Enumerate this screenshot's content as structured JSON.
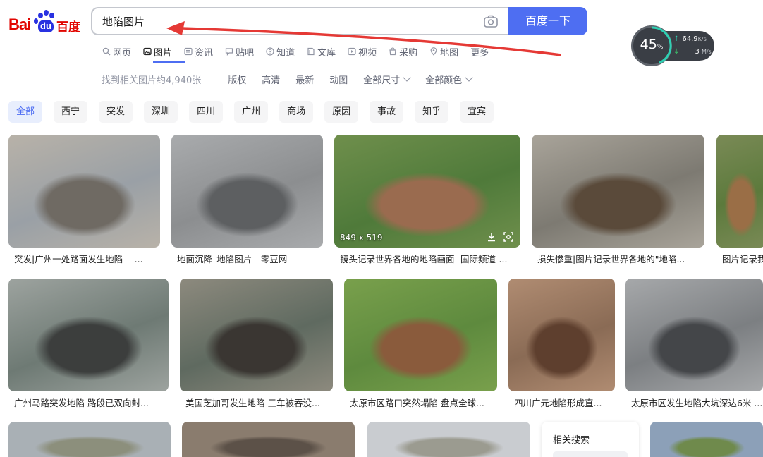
{
  "logo": {
    "latin": "Bai",
    "du": "du",
    "chinese": "百度"
  },
  "search": {
    "query": "地陷图片",
    "button_label": "百度一下"
  },
  "nav": [
    {
      "label": "网页",
      "icon": "search-icon"
    },
    {
      "label": "图片",
      "icon": "image-icon",
      "active": true
    },
    {
      "label": "资讯",
      "icon": "news-icon"
    },
    {
      "label": "贴吧",
      "icon": "tieba-icon"
    },
    {
      "label": "知道",
      "icon": "question-icon"
    },
    {
      "label": "文库",
      "icon": "doc-icon"
    },
    {
      "label": "视频",
      "icon": "video-icon"
    },
    {
      "label": "采购",
      "icon": "shop-icon"
    },
    {
      "label": "地图",
      "icon": "map-icon"
    },
    {
      "label": "更多",
      "icon": ""
    }
  ],
  "filters": {
    "count": "找到相关图片约4,940张",
    "items": [
      "版权",
      "高清",
      "最新",
      "动图"
    ],
    "dropdowns": [
      "全部尺寸",
      "全部颜色"
    ]
  },
  "chips": [
    "全部",
    "西宁",
    "突发",
    "深圳",
    "四川",
    "广州",
    "商场",
    "原因",
    "事故",
    "知乎",
    "宜宾"
  ],
  "row1": [
    {
      "caption": "突发|广州一处路面发生地陷 —...",
      "colors": [
        "#9aa0a6",
        "#6f6a63",
        "#b8b2a8"
      ]
    },
    {
      "caption": "地面沉降_地陷图片 - 零豆网",
      "colors": [
        "#8c8e90",
        "#5d5f61",
        "#a9abad"
      ]
    },
    {
      "caption": "镜头记录世界各地的地陷画面 -国际频道-...",
      "colors": [
        "#4f7a3a",
        "#9a6b4f",
        "#6f8f4c"
      ],
      "size": "849 x 519"
    },
    {
      "caption": "损失惨重|图片记录世界各地的\"地陷...",
      "colors": [
        "#7d7a72",
        "#5a4a3a",
        "#a9a49a"
      ]
    },
    {
      "caption": "图片记录我",
      "colors": [
        "#5c7a3c",
        "#9a6e46",
        "#7a8a56"
      ]
    }
  ],
  "row2": [
    {
      "caption": "广州马路突发地陷 路段已双向封...",
      "colors": [
        "#6e7a74",
        "#3c3e3d",
        "#9da39f"
      ]
    },
    {
      "caption": "美国芝加哥发生地陷 三车被吞没...",
      "colors": [
        "#5f6a60",
        "#3a3632",
        "#8d8a7e"
      ]
    },
    {
      "caption": "太原市区路口突然塌陷 盘点全球...",
      "colors": [
        "#5e8a3e",
        "#8a5b3c",
        "#79a04c"
      ]
    },
    {
      "caption": "四川广元地陷形成直...",
      "colors": [
        "#8a6b55",
        "#5e3f2e",
        "#b08c72"
      ]
    },
    {
      "caption": "太原市区发生地陷大坑深达6米 ...",
      "colors": [
        "#7c7f82",
        "#444649",
        "#a6a8aa"
      ]
    }
  ],
  "row3": [
    {
      "colors": [
        "#a9b0b5",
        "#8c8f7c"
      ]
    },
    {
      "colors": [
        "#8a7c6e",
        "#5c5148"
      ]
    },
    {
      "colors": [
        "#c9ccd0",
        "#9b9b90"
      ]
    },
    {
      "colors": [
        "#8ca0b8",
        "#6f8a4c"
      ]
    }
  ],
  "related": {
    "title": "相关搜索"
  },
  "speed": {
    "percent": "45",
    "percent_unit": "%",
    "up": "64.9",
    "up_unit": "K/s",
    "down": "3",
    "down_unit": "M/s"
  }
}
